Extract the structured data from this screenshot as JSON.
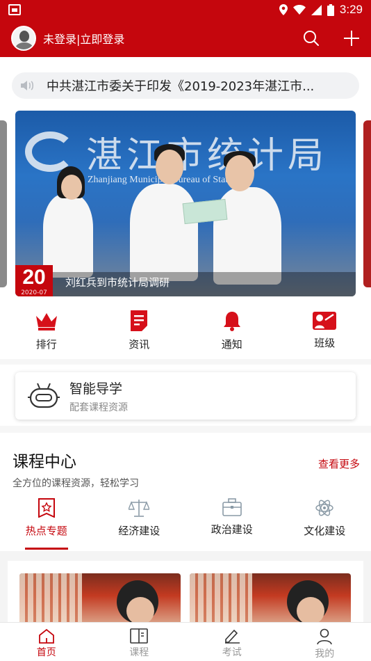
{
  "status_bar": {
    "time": "3:29"
  },
  "header": {
    "login_text": "未登录|立即登录"
  },
  "notice": {
    "text": "中共湛江市委关于印发《2019-2023年湛江市..."
  },
  "banner": {
    "wall_title": "湛江市统计局",
    "wall_subtitle": "Zhanjiang Municipal Bureau of Statistics",
    "day": "20",
    "year_month": "2020-07",
    "caption": "刘红兵到市统计局调研"
  },
  "quick_links": [
    {
      "label": "排行",
      "icon": "crown-icon"
    },
    {
      "label": "资讯",
      "icon": "document-icon"
    },
    {
      "label": "通知",
      "icon": "bell-icon"
    },
    {
      "label": "班级",
      "icon": "class-icon"
    }
  ],
  "smart_guide": {
    "title": "智能导学",
    "subtitle": "配套课程资源"
  },
  "course_center": {
    "title": "课程中心",
    "subtitle": "全方位的课程资源，轻松学习",
    "more": "查看更多",
    "tabs": [
      {
        "label": "热点专题",
        "icon": "bookmark-star-icon",
        "active": true
      },
      {
        "label": "经济建设",
        "icon": "scale-icon",
        "active": false
      },
      {
        "label": "政治建设",
        "icon": "briefcase-icon",
        "active": false
      },
      {
        "label": "文化建设",
        "icon": "atom-icon",
        "active": false
      }
    ]
  },
  "bottom_nav": [
    {
      "label": "首页",
      "icon": "home-icon",
      "active": true
    },
    {
      "label": "课程",
      "icon": "book-icon",
      "active": false
    },
    {
      "label": "考试",
      "icon": "pen-icon",
      "active": false
    },
    {
      "label": "我的",
      "icon": "user-icon",
      "active": false
    }
  ],
  "colors": {
    "brand_red": "#c5060d",
    "inactive_gray": "#999999"
  }
}
